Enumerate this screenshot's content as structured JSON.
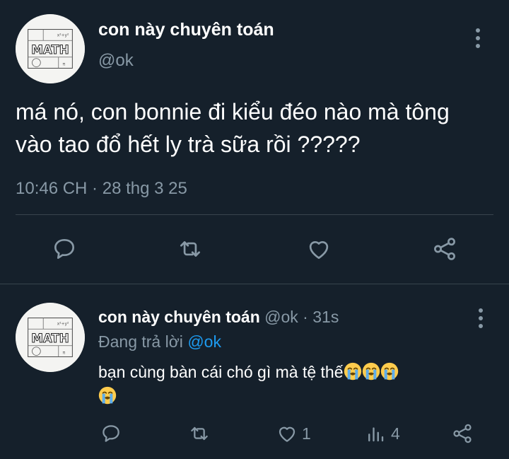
{
  "main_tweet": {
    "display_name": "con này chuyên toán",
    "handle": "@ok",
    "text_line1": "má nó, con bonnie đi kiểu đéo nào mà tông",
    "text_line2": "vào tao đổ hết ly trà sữa rồi ?????",
    "timestamp": "10:46 CH · 28 thg 3 25",
    "avatar_text": "MATH"
  },
  "reply_tweet": {
    "display_name": "con này chuyên toán",
    "handle_time": "@ok · 31s",
    "replying_prefix": "Đang trả lời",
    "replying_to": "@ok",
    "text": "bạn cùng bàn cái chó gì mà tệ thế",
    "emoji_count": 4,
    "emoji_name": "loudly-crying-face",
    "like_count": "1",
    "view_count": "4",
    "avatar_text": "MATH"
  },
  "colors": {
    "background": "#15202b",
    "muted": "#8899a6",
    "link": "#1d9bf0",
    "divider": "#38444d"
  },
  "icons": [
    "more-vertical-icon",
    "reply-icon",
    "retweet-icon",
    "like-icon",
    "share-icon",
    "views-icon"
  ]
}
